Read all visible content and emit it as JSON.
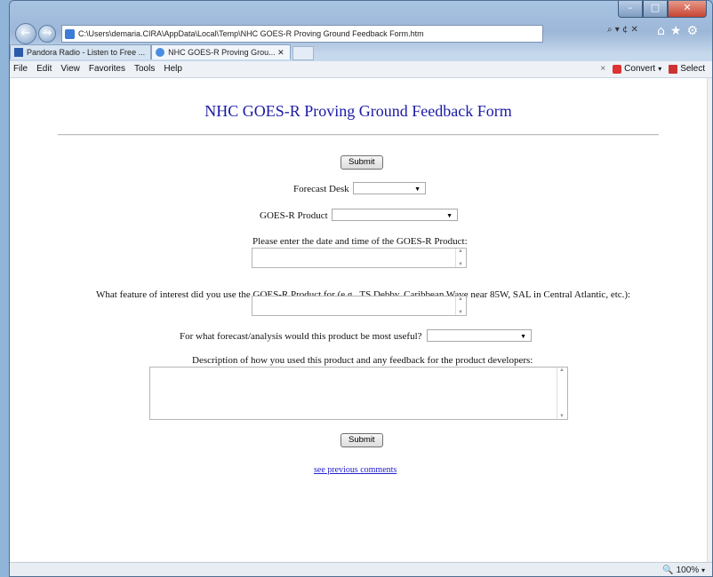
{
  "browser": {
    "address": "C:\\Users\\demaria.CIRA\\AppData\\Local\\Temp\\NHC GOES-R Proving Ground Feedback Form.htm",
    "address_actions": "⌕ ▾ ¢ ✕",
    "tabs": [
      {
        "label": "Pandora Radio - Listen to Free ..."
      },
      {
        "label": "NHC GOES-R Proving Grou... ✕"
      }
    ],
    "menu": [
      "File",
      "Edit",
      "View",
      "Favorites",
      "Tools",
      "Help"
    ],
    "toolbar_right": {
      "close": "×",
      "convert": "Convert",
      "convert_arrow": "▾",
      "select": "Select"
    },
    "zoom": "100%",
    "zoom_arrow": "▾"
  },
  "form": {
    "title": "NHC GOES-R Proving Ground Feedback Form",
    "submit_label": "Submit",
    "forecast_desk_label": "Forecast Desk",
    "forecast_desk_value": "",
    "product_label": "GOES-R Product",
    "product_value": "",
    "datetime_label": "Please enter the date and time of the GOES-R Product:",
    "datetime_value": "",
    "feature_label": "What feature of interest did you use the GOES-R Product for (e.g., TS Debby, Caribbean Wave near 85W, SAL in Central Atlantic, etc.):",
    "feature_value": "",
    "usefulness_label": "For what forecast/analysis would this product be most useful?",
    "usefulness_value": "",
    "description_label": "Description of how you used this product and any feedback for the product developers:",
    "description_value": "",
    "previous_link": "see previous comments"
  },
  "colors": {
    "title_text": "#1a1aa6",
    "link_text": "#2222cc"
  },
  "icons": [
    "back-arrow-icon",
    "forward-arrow-icon",
    "page-icon",
    "search-icon",
    "refresh-icon",
    "close-icon",
    "home-icon",
    "favorites-star-icon",
    "gear-icon",
    "dropdown-arrow-icon",
    "zoom-icon"
  ]
}
